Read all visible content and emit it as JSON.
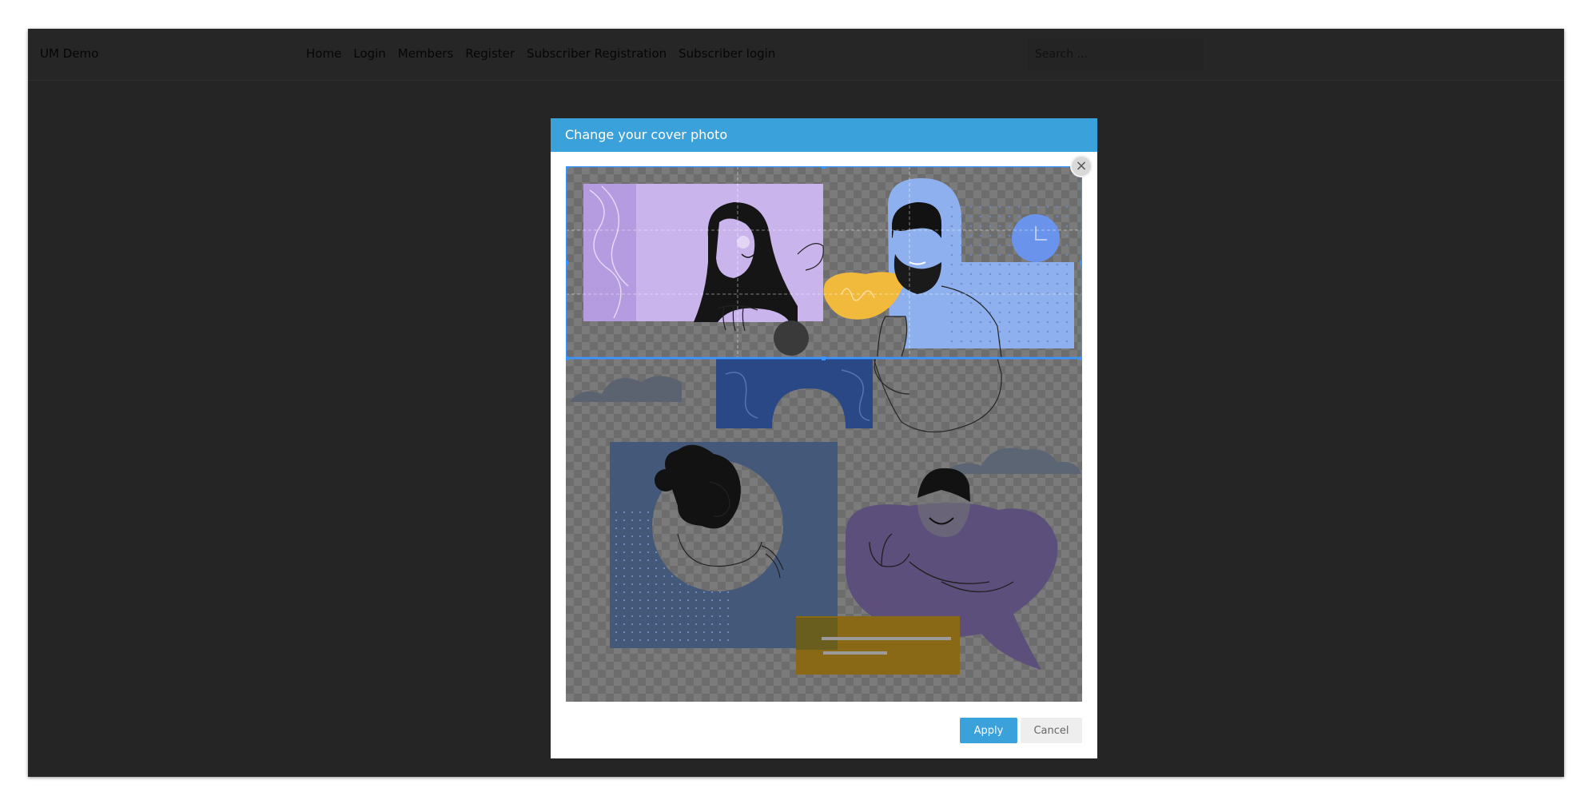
{
  "navbar": {
    "brand": "UM Demo",
    "links": [
      "Home",
      "Login",
      "Members",
      "Register",
      "Subscriber Registration",
      "Subscriber login"
    ],
    "search_placeholder": "Search ..."
  },
  "modal": {
    "title": "Change your cover photo",
    "apply_label": "Apply",
    "cancel_label": "Cancel",
    "close_symbol": "×"
  },
  "colors": {
    "accent": "#3ba1da",
    "backdrop": "#252525"
  },
  "icons": [
    "close-icon"
  ]
}
